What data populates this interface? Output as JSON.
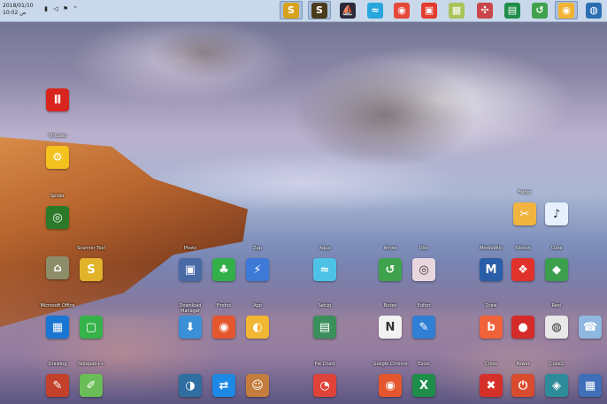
{
  "taskbar": {
    "clock_line1": "2018/01/10",
    "clock_line2": "ص 10:02",
    "tray_icons": [
      "network-icon",
      "speaker-icon",
      "flag-icon",
      "chevron-up-icon"
    ],
    "pinned": [
      {
        "name": "s-app-icon",
        "glyph": "S",
        "color": "#d7a21e",
        "active": true
      },
      {
        "name": "s-app-icon",
        "glyph": "S",
        "color": "#4a3b1d",
        "active": true
      },
      {
        "name": "ship-icon",
        "glyph": "⛵",
        "color": "#2a2a3a",
        "active": false
      },
      {
        "name": "wave-icon",
        "glyph": "≈",
        "color": "#29a6de",
        "active": false
      },
      {
        "name": "chrome-icon",
        "glyph": "◉",
        "color": "#e5493a",
        "active": false
      },
      {
        "name": "red-box-icon",
        "glyph": "▣",
        "color": "#e33b2e",
        "active": false
      },
      {
        "name": "map-icon",
        "glyph": "▦",
        "color": "#a8c45a",
        "active": false
      },
      {
        "name": "tools-icon",
        "glyph": "✣",
        "color": "#c9464a",
        "active": false
      },
      {
        "name": "excel-icon",
        "glyph": "▤",
        "color": "#1f8d4a",
        "active": false
      },
      {
        "name": "green-arrow-icon",
        "glyph": "↺",
        "color": "#3fa34d",
        "active": false
      },
      {
        "name": "chrome-icon",
        "glyph": "◉",
        "color": "#f2b233",
        "active": true
      },
      {
        "name": "start-orb-icon",
        "glyph": "◍",
        "color": "#2b6fb3",
        "active": false
      }
    ]
  },
  "desktop_icons": [
    {
      "name": "red-tool-icon",
      "glyph": "Ⅱ",
      "color": "#d8261e",
      "label": ""
    },
    {
      "name": "yellow-gear-icon",
      "glyph": "⚙",
      "color": "#f4c21e",
      "label": "Virtuoso"
    },
    {
      "name": "green-radar-icon",
      "glyph": "◎",
      "color": "#2b7a2a",
      "label": "Spider"
    },
    {
      "name": "scanner-icon",
      "glyph": "⌂",
      "color": "#8d8d6a",
      "label": ""
    },
    {
      "name": "s-app-icon",
      "glyph": "S",
      "color": "#e2b22a",
      "label": "Scanner Tool"
    },
    {
      "name": "windows-flag-icon",
      "glyph": "▦",
      "color": "#1976d2",
      "label": "Microsoft Office"
    },
    {
      "name": "green-square-icon",
      "glyph": "▢",
      "color": "#36b24a",
      "label": ""
    },
    {
      "name": "red-pdf-icon",
      "glyph": "✎",
      "color": "#c3402b",
      "label": "Drawing"
    },
    {
      "name": "notepad-icon",
      "glyph": "✐",
      "color": "#6bbd57",
      "label": "Notepad++"
    },
    {
      "name": "photo-icon",
      "glyph": "▣",
      "color": "#4a6aa6",
      "label": "Photo"
    },
    {
      "name": "clover-icon",
      "glyph": "♣",
      "color": "#34b04a",
      "label": ""
    },
    {
      "name": "lightning-icon",
      "glyph": "⚡",
      "color": "#3d7ad8",
      "label": "Zap"
    },
    {
      "name": "download-icon",
      "glyph": "⬇",
      "color": "#3a8fd6",
      "label": "Download Manager"
    },
    {
      "name": "chrome-color-icon",
      "glyph": "◉",
      "color": "#e4572e",
      "label": "Firefox"
    },
    {
      "name": "yellow-app-icon",
      "glyph": "◐",
      "color": "#f2b632",
      "label": "App"
    },
    {
      "name": "steam-icon",
      "glyph": "◑",
      "color": "#2f6ea0",
      "label": ""
    },
    {
      "name": "teamviewer-icon",
      "glyph": "⇄",
      "color": "#1e88e5",
      "label": ""
    },
    {
      "name": "game-icon",
      "glyph": "☺",
      "color": "#c57d3d",
      "label": ""
    },
    {
      "name": "wave-app-icon",
      "glyph": "≈",
      "color": "#4cc3e6",
      "label": "Aqua"
    },
    {
      "name": "recorder-icon",
      "glyph": "▤",
      "color": "#3b8f5a",
      "label": "Setup"
    },
    {
      "name": "pie-icon",
      "glyph": "◔",
      "color": "#e0433a",
      "label": "Pie Chart"
    },
    {
      "name": "word-icon",
      "glyph": "N",
      "color": "#f2f2f2",
      "label": "Notes"
    },
    {
      "name": "green-arrow-icon",
      "glyph": "↺",
      "color": "#3fa34d",
      "label": "Arrow"
    },
    {
      "name": "cd-icon",
      "glyph": "◎",
      "color": "#e9d7df",
      "label": "Disc"
    },
    {
      "name": "edit-icon",
      "glyph": "✎",
      "color": "#2f7fd4",
      "label": "Editor"
    },
    {
      "name": "chrome-icon",
      "glyph": "◉",
      "color": "#e4572e",
      "label": "Google Chrome"
    },
    {
      "name": "excel-icon",
      "glyph": "X",
      "color": "#1e8e4a",
      "label": "Excel"
    },
    {
      "name": "mw-icon",
      "glyph": "M",
      "color": "#2a5ea8",
      "label": "MediaWiki"
    },
    {
      "name": "draw-icon",
      "glyph": "b",
      "color": "#f0633a",
      "label": "Draw"
    },
    {
      "name": "cross-icon",
      "glyph": "✖",
      "color": "#d6302a",
      "label": "Cross"
    },
    {
      "name": "red-ribbon-icon",
      "glyph": "❖",
      "color": "#e0322a",
      "label": "Ribbon"
    },
    {
      "name": "red-circle-icon",
      "glyph": "●",
      "color": "#d42a28",
      "label": ""
    },
    {
      "name": "power-icon",
      "glyph": "⏻",
      "color": "#d94b2e",
      "label": "Power"
    },
    {
      "name": "folder-icon",
      "glyph": "✂",
      "color": "#f1b43f",
      "label": "Folder"
    },
    {
      "name": "green-cube-icon",
      "glyph": "◆",
      "color": "#3c9f4c",
      "label": "Cube"
    },
    {
      "name": "reel-icon",
      "glyph": "◍",
      "color": "#e8e8e8",
      "label": "Reel"
    },
    {
      "name": "cube-icon",
      "glyph": "◈",
      "color": "#2e8c9a",
      "label": "Cube2"
    },
    {
      "name": "music-icon",
      "glyph": "♪",
      "color": "#e7f0ff",
      "label": ""
    },
    {
      "name": "phone-icon",
      "glyph": "☎",
      "color": "#8fb8e0",
      "label": ""
    },
    {
      "name": "windows-icon",
      "glyph": "▦",
      "color": "#3f6fb8",
      "label": ""
    }
  ]
}
